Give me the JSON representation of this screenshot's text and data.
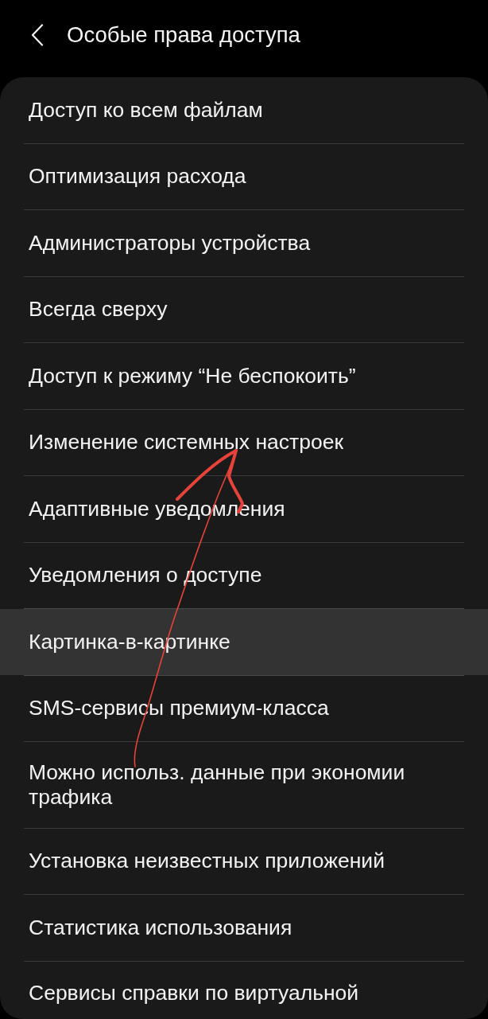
{
  "header": {
    "title": "Особые права доступа"
  },
  "items": [
    {
      "label": "Доступ ко всем файлам",
      "selected": false
    },
    {
      "label": "Оптимизация расхода",
      "selected": false
    },
    {
      "label": "Администраторы устройства",
      "selected": false
    },
    {
      "label": "Всегда сверху",
      "selected": false
    },
    {
      "label": "Доступ к режиму “Не беспокоить”",
      "selected": false
    },
    {
      "label": "Изменение системных настроек",
      "selected": false
    },
    {
      "label": "Адаптивные уведомления",
      "selected": false
    },
    {
      "label": "Уведомления о доступе",
      "selected": false
    },
    {
      "label": "Картинка-в-картинке",
      "selected": true
    },
    {
      "label": "SMS-сервисы премиум-класса",
      "selected": false
    },
    {
      "label": "Можно использ. данные при экономии трафика",
      "selected": false
    },
    {
      "label": "Установка неизвестных приложений",
      "selected": false
    },
    {
      "label": "Статистика использования",
      "selected": false
    },
    {
      "label": "Сервисы справки по виртуальной",
      "selected": false
    }
  ],
  "annotations": [
    {
      "kind": "arrow"
    }
  ]
}
